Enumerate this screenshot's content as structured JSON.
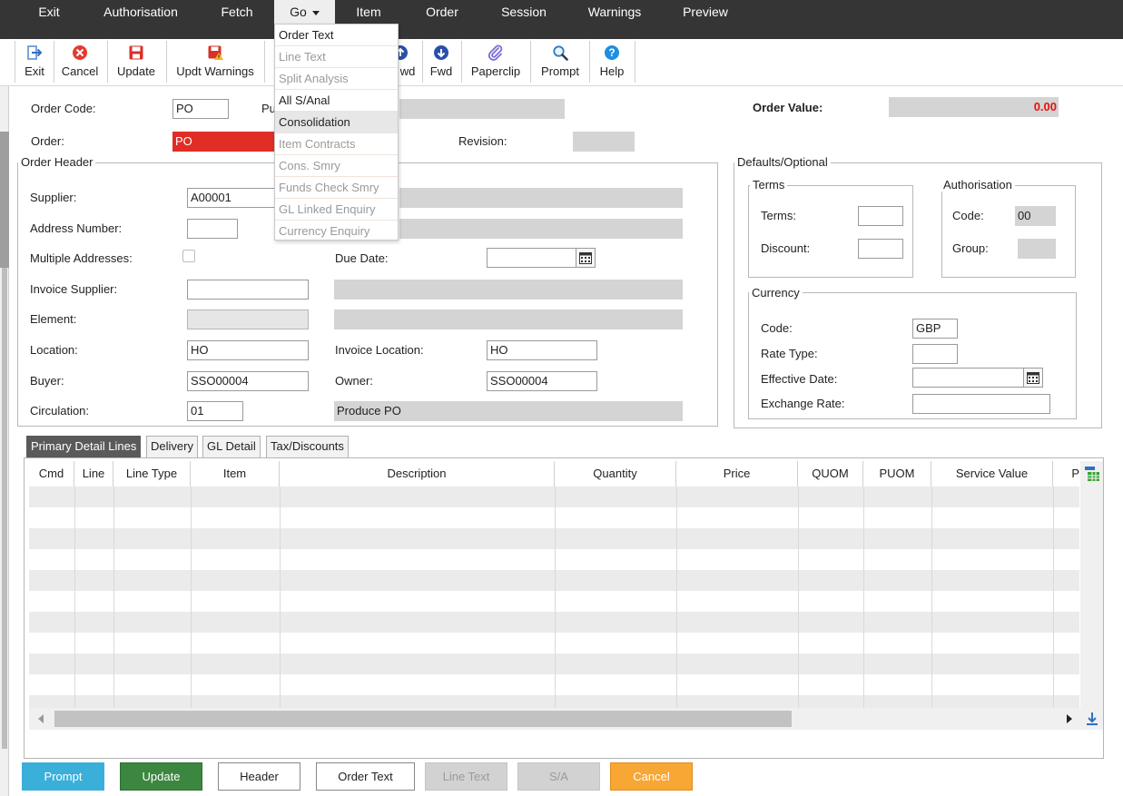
{
  "menubar": {
    "items": [
      "Exit",
      "Authorisation",
      "Fetch",
      "Go",
      "Item",
      "Order",
      "Session",
      "Warnings",
      "Preview"
    ],
    "active": "Go"
  },
  "toolbar": {
    "exit": "Exit",
    "cancel": "Cancel",
    "update": "Update",
    "updt_warnings": "Updt Warnings",
    "bwd": "wd",
    "fwd": "Fwd",
    "paperclip": "Paperclip",
    "prompt": "Prompt",
    "help": "Help"
  },
  "go_menu": {
    "items": [
      {
        "label": "Order Text",
        "enabled": true
      },
      {
        "label": "Line Text",
        "enabled": false
      },
      {
        "label": "Split Analysis",
        "enabled": false
      },
      {
        "label": "All S/Anal",
        "enabled": true
      },
      {
        "label": "Consolidation",
        "enabled": true
      },
      {
        "label": "Item Contracts",
        "enabled": false
      },
      {
        "label": "Cons. Smry",
        "enabled": false
      },
      {
        "label": "Funds Check Smry",
        "enabled": false
      },
      {
        "label": "GL Linked Enquiry",
        "enabled": false
      },
      {
        "label": "Currency Enquiry",
        "enabled": false
      }
    ]
  },
  "top": {
    "order_code_label": "Order Code:",
    "order_code_value": "PO",
    "order_code_desc": "Pu",
    "order_value_label": "Order Value:",
    "order_value": "0.00",
    "order_label": "Order:",
    "order_value_field": "PO",
    "revision_label": "Revision:",
    "revision_value": ""
  },
  "order_header": {
    "legend": "Order Header",
    "supplier_label": "Supplier:",
    "supplier_value": "A00001",
    "address_number_label": "Address Number:",
    "address_number_value": "",
    "multiple_addresses_label": "Multiple Addresses:",
    "due_date_label": "Due Date:",
    "due_date_value": "",
    "invoice_supplier_label": "Invoice Supplier:",
    "invoice_supplier_value": "",
    "element_label": "Element:",
    "element_value": "",
    "location_label": "Location:",
    "location_value": "HO",
    "invoice_location_label": "Invoice Location:",
    "invoice_location_value": "HO",
    "buyer_label": "Buyer:",
    "buyer_value": "SSO00004",
    "owner_label": "Owner:",
    "owner_value": "SSO00004",
    "circulation_label": "Circulation:",
    "circulation_value": "01",
    "circulation_desc": "Produce PO"
  },
  "defaults": {
    "legend": "Defaults/Optional",
    "terms_legend": "Terms",
    "terms_label": "Terms:",
    "terms_value": "",
    "discount_label": "Discount:",
    "discount_value": "",
    "auth_legend": "Authorisation",
    "auth_code_label": "Code:",
    "auth_code_value": "00",
    "auth_group_label": "Group:",
    "auth_group_value": "",
    "currency_legend": "Currency",
    "cur_code_label": "Code:",
    "cur_code_value": "GBP",
    "rate_type_label": "Rate Type:",
    "rate_type_value": "",
    "effective_date_label": "Effective Date:",
    "effective_date_value": "",
    "exchange_rate_label": "Exchange Rate:",
    "exchange_rate_value": ""
  },
  "tabs": [
    "Primary Detail Lines",
    "Delivery",
    "GL Detail",
    "Tax/Discounts"
  ],
  "active_tab": "Primary Detail Lines",
  "grid": {
    "columns": [
      "Cmd",
      "Line",
      "Line Type",
      "Item",
      "Description",
      "Quantity",
      "Price",
      "QUOM",
      "PUOM",
      "Service Value",
      "P"
    ]
  },
  "buttons": {
    "prompt": "Prompt",
    "update": "Update",
    "header": "Header",
    "order_text": "Order Text",
    "line_text": "Line Text",
    "sa": "S/A",
    "cancel": "Cancel"
  },
  "colors": {
    "menubar_bg": "#353535",
    "order_value_red": "#e3120b",
    "order_field_red": "#e02d26",
    "prompt_blue": "#3aafd9",
    "update_green": "#3c873f",
    "cancel_orange": "#f8a634"
  }
}
